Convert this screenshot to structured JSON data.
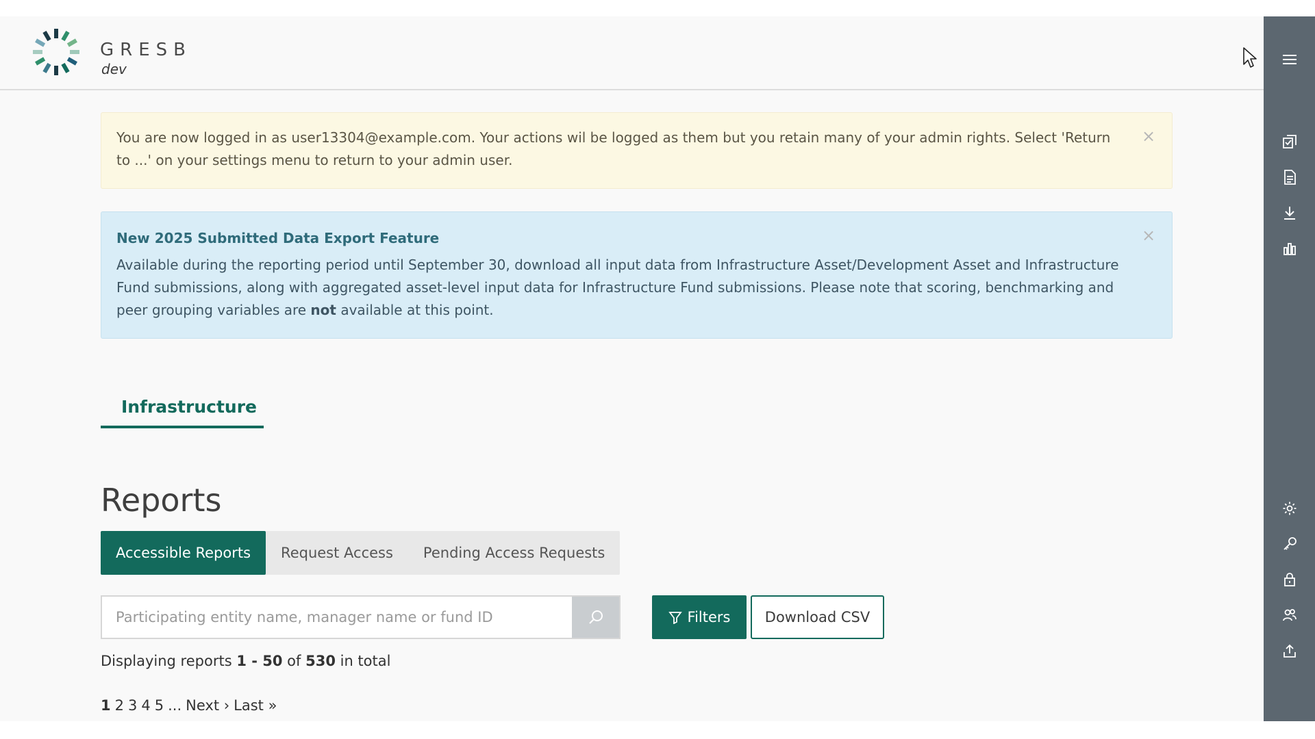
{
  "header": {
    "brand": "GRESB",
    "environment": "dev"
  },
  "alerts": {
    "impersonation": {
      "text": "You are now logged in as user13304@example.com. Your actions wil be logged as them but you retain many of your admin rights. Select 'Return to ...' on your settings menu to return to your admin user.",
      "close": "×"
    },
    "feature": {
      "title": "New 2025 Submitted Data Export Feature",
      "text_before": "Available during the reporting period until September 30, download all input data from Infrastructure Asset/Development Asset and Infrastructure Fund submissions, along with aggregated asset-level input data for Infrastructure Fund submissions. Please note that scoring, benchmarking and peer grouping variables are ",
      "text_bold": "not",
      "text_after": " available at this point.",
      "close": "×"
    }
  },
  "section_tab": {
    "label": "Infrastructure"
  },
  "page": {
    "title": "Reports"
  },
  "report_tabs": [
    {
      "label": "Accessible Reports",
      "active": true
    },
    {
      "label": "Request Access",
      "active": false
    },
    {
      "label": "Pending Access Requests",
      "active": false
    }
  ],
  "search": {
    "placeholder": "Participating entity name, manager name or fund ID",
    "value": ""
  },
  "buttons": {
    "filters": "Filters",
    "download_csv": "Download CSV"
  },
  "display": {
    "prefix": "Displaying reports ",
    "range": "1 - 50",
    "of": " of ",
    "total": "530",
    "suffix": " in total"
  },
  "pagination": {
    "pages": [
      "1",
      "2",
      "3",
      "4",
      "5"
    ],
    "current": "1",
    "ellipsis": "...",
    "next": "Next ›",
    "last": "Last »"
  },
  "sidebar_icons": [
    "menu-icon",
    "checklist-icon",
    "document-icon",
    "download-icon",
    "bar-chart-icon",
    "gear-icon",
    "key-icon",
    "lock-icon",
    "users-icon",
    "upload-icon"
  ],
  "colors": {
    "brand_green": "#136a5c",
    "sidebar": "#5c6770",
    "warning_bg": "#fcf8e3",
    "info_bg": "#d9edf7"
  }
}
